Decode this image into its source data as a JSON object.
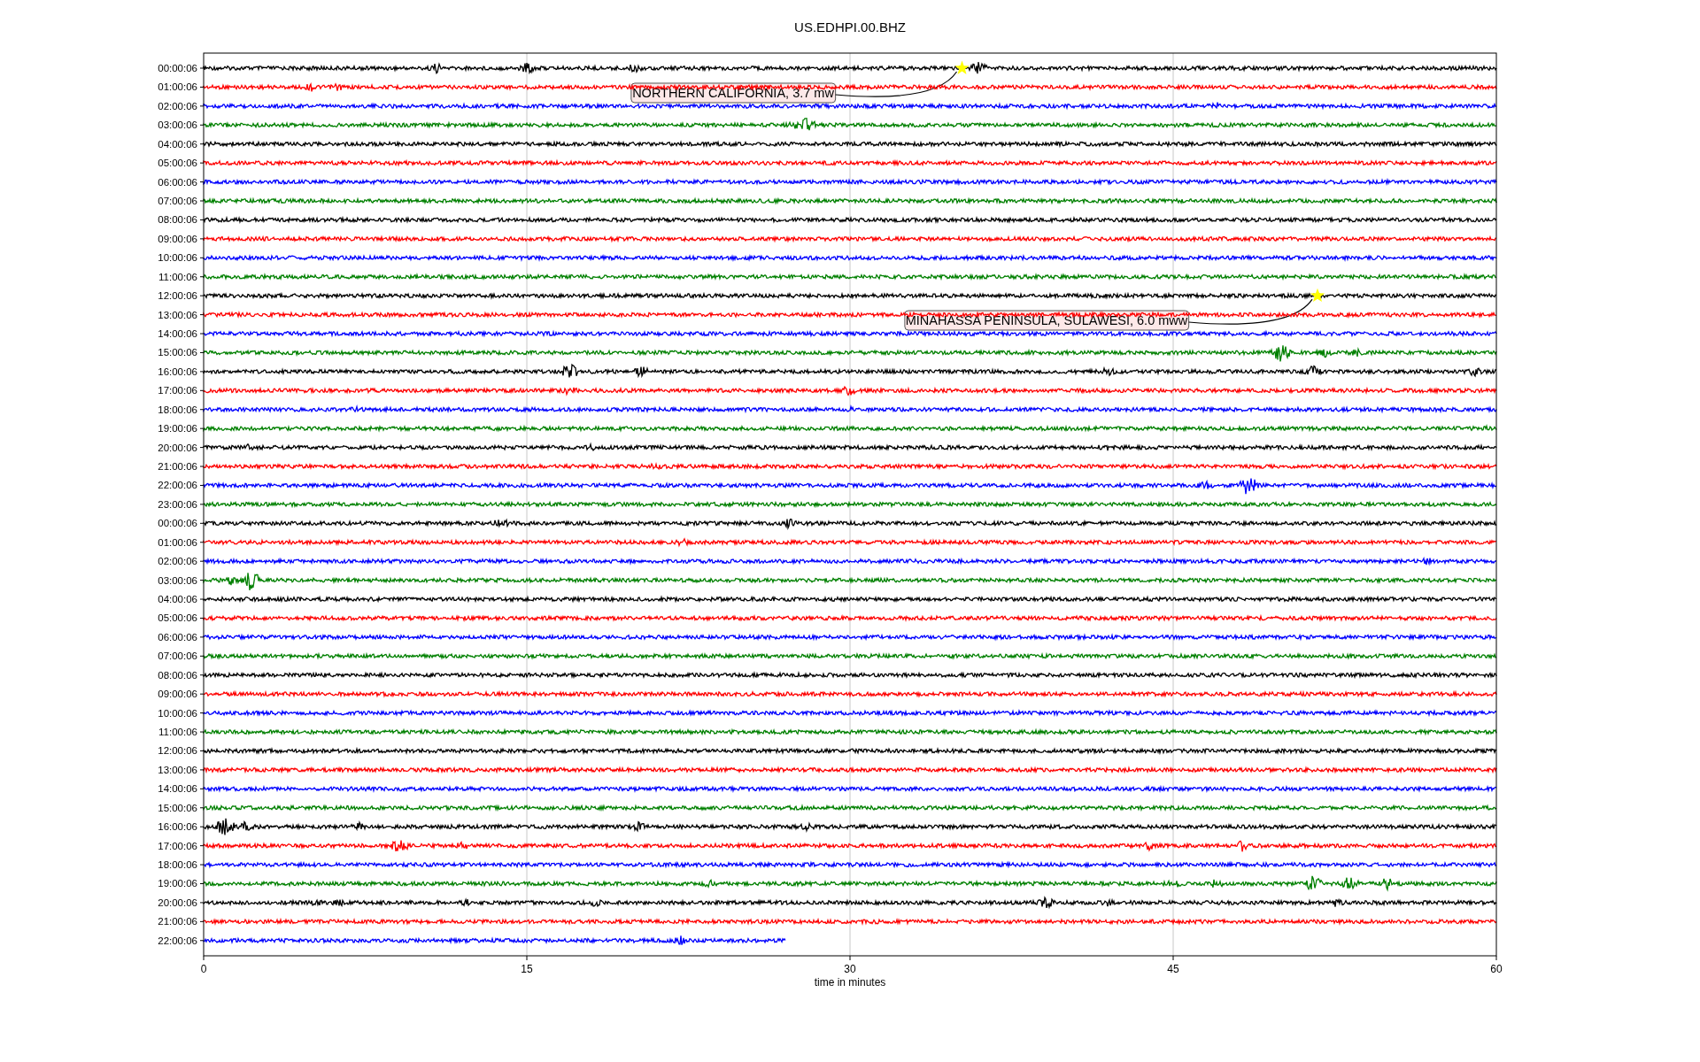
{
  "title": "US.EDHPI.00.BHZ",
  "rows": [
    {
      "label": "00:00:06",
      "color": "#000000",
      "event": {
        "label": "NORTHERN CALIFORNIA, 3.7 mw"
      }
    },
    {
      "label": "01:00:06",
      "color": "#ff0000"
    },
    {
      "label": "02:00:06",
      "color": "#0000ff"
    },
    {
      "label": "03:00:06",
      "color": "#008000"
    },
    {
      "label": "04:00:06",
      "color": "#000000"
    },
    {
      "label": "05:00:06",
      "color": "#ff0000"
    },
    {
      "label": "06:00:06",
      "color": "#0000ff"
    },
    {
      "label": "07:00:06",
      "color": "#008000"
    },
    {
      "label": "08:00:06",
      "color": "#000000"
    },
    {
      "label": "09:00:06",
      "color": "#ff0000"
    },
    {
      "label": "10:00:06",
      "color": "#0000ff"
    },
    {
      "label": "11:00:06",
      "color": "#008000"
    },
    {
      "label": "12:00:06",
      "color": "#000000",
      "event": {
        "label": "MINAHASSA PENINSULA, SULAWESI, 6.0 mww"
      }
    },
    {
      "label": "13:00:06",
      "color": "#ff0000"
    },
    {
      "label": "14:00:06",
      "color": "#0000ff"
    },
    {
      "label": "15:00:06",
      "color": "#008000"
    },
    {
      "label": "16:00:06",
      "color": "#000000"
    },
    {
      "label": "17:00:06",
      "color": "#ff0000"
    },
    {
      "label": "18:00:06",
      "color": "#0000ff"
    },
    {
      "label": "19:00:06",
      "color": "#008000"
    },
    {
      "label": "20:00:06",
      "color": "#000000"
    },
    {
      "label": "21:00:06",
      "color": "#ff0000"
    },
    {
      "label": "22:00:06",
      "color": "#0000ff"
    },
    {
      "label": "23:00:06",
      "color": "#008000"
    },
    {
      "label": "00:00:06",
      "color": "#000000"
    },
    {
      "label": "01:00:06",
      "color": "#ff0000"
    },
    {
      "label": "02:00:06",
      "color": "#0000ff"
    },
    {
      "label": "03:00:06",
      "color": "#008000"
    },
    {
      "label": "04:00:06",
      "color": "#000000"
    },
    {
      "label": "05:00:06",
      "color": "#ff0000"
    },
    {
      "label": "06:00:06",
      "color": "#0000ff"
    },
    {
      "label": "07:00:06",
      "color": "#008000"
    },
    {
      "label": "08:00:06",
      "color": "#000000"
    },
    {
      "label": "09:00:06",
      "color": "#ff0000"
    },
    {
      "label": "10:00:06",
      "color": "#0000ff"
    },
    {
      "label": "11:00:06",
      "color": "#008000"
    },
    {
      "label": "12:00:06",
      "color": "#000000"
    },
    {
      "label": "13:00:06",
      "color": "#ff0000"
    },
    {
      "label": "14:00:06",
      "color": "#0000ff"
    },
    {
      "label": "15:00:06",
      "color": "#008000"
    },
    {
      "label": "16:00:06",
      "color": "#000000"
    },
    {
      "label": "17:00:06",
      "color": "#ff0000"
    },
    {
      "label": "18:00:06",
      "color": "#0000ff"
    },
    {
      "label": "19:00:06",
      "color": "#008000"
    },
    {
      "label": "20:00:06",
      "color": "#000000"
    },
    {
      "label": "21:00:06",
      "color": "#ff0000"
    },
    {
      "label": "22:00:06",
      "color": "#0000ff",
      "level": 0.45
    }
  ],
  "x_axis": {
    "ticks": [
      "0",
      "15",
      "30",
      "45",
      "60"
    ],
    "label": "time in minutes"
  }
}
